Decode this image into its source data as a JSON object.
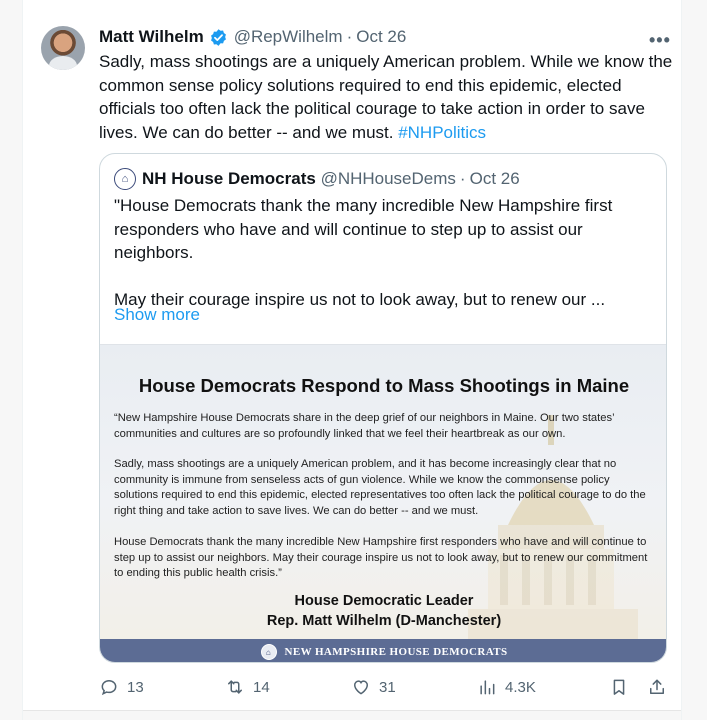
{
  "tweet": {
    "author_name": "Matt Wilhelm",
    "handle": "@RepWilhelm",
    "separator": "·",
    "date": "Oct 26",
    "more_label": "•••",
    "text": "Sadly, mass shootings are a uniquely American problem. While we know the common sense policy solutions required to end this epidemic, elected officials too often lack the political courage to take action in order to save lives. We can do better -- and we must. ",
    "hashtag": "#NHPolitics"
  },
  "quote": {
    "name": "NH House Democrats",
    "handle": "@NHHouseDems",
    "separator": "·",
    "date": "Oct 26",
    "paragraph1": "\"House Democrats thank the many incredible New Hampshire first responders who have and will continue to step up to assist our neighbors.",
    "paragraph2": "May their courage inspire us not to look away, but to renew our ...",
    "show_more": "Show more",
    "image": {
      "title": "House Democrats Respond to Mass Shootings in Maine",
      "p1": "“New Hampshire House Democrats share in the deep grief of our neighbors in Maine. Our two states’ communities and cultures are so profoundly linked that we feel their heartbreak as our own.",
      "p2": "Sadly, mass shootings are a uniquely American problem, and it has become increasingly clear that no community is immune from senseless acts of gun violence. While we know the commonsense policy solutions required to end this epidemic, elected representatives too often lack the political courage to do the right thing and take action to save lives. We can do better -- and we must.",
      "p3": "House Democrats thank the many incredible New Hampshire first responders who have and will continue to step up to assist our neighbors. May their courage inspire us not to look away, but to renew our commitment to ending this public health crisis.”",
      "signature_title": "House Democratic Leader",
      "signature_name": "Rep. Matt Wilhelm (D-Manchester)",
      "banner": "NEW HAMPSHIRE HOUSE DEMOCRATS"
    }
  },
  "actions": {
    "replies": "13",
    "retweets": "14",
    "likes": "31",
    "views": "4.3K"
  },
  "colors": {
    "link": "#1d9bf0",
    "verified": "#1d9bf0",
    "secondary_text": "#536471",
    "banner": "#5c6c94"
  },
  "icons": [
    "verified-icon",
    "more-icon",
    "reply-icon",
    "retweet-icon",
    "like-icon",
    "views-icon",
    "bookmark-icon",
    "share-icon"
  ]
}
